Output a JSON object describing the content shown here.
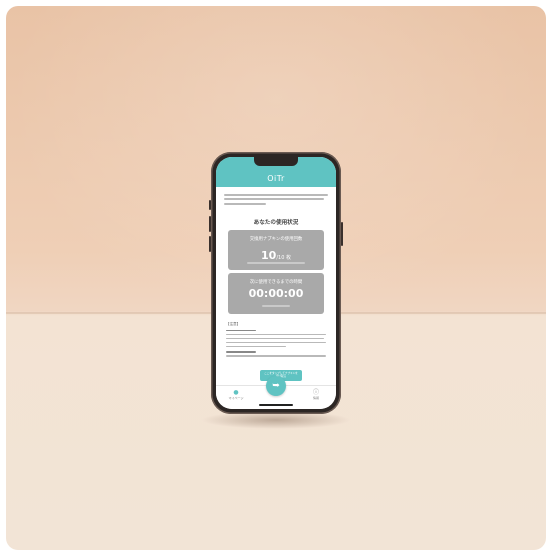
{
  "app": {
    "title": "OiTr",
    "section_title": "あなたの使用状況",
    "card1": {
      "label": "交換用ナプキンの使用回数",
      "value": "10",
      "unit": "/10 枚"
    },
    "card2": {
      "label": "次に使用できるまでの時間",
      "value": "00:00:00"
    },
    "body": {
      "heading": "【注意】"
    },
    "tooltip": {
      "line1": "ここをタップしてナプキンを",
      "line2": "受け取る"
    },
    "tabs": {
      "left_label": "マイページ",
      "right_label": "情報"
    }
  },
  "colors": {
    "accent": "#5fc3c2",
    "card": "#a9a9a9",
    "wall": "#e9c3a6",
    "table": "#f2e4d6"
  }
}
